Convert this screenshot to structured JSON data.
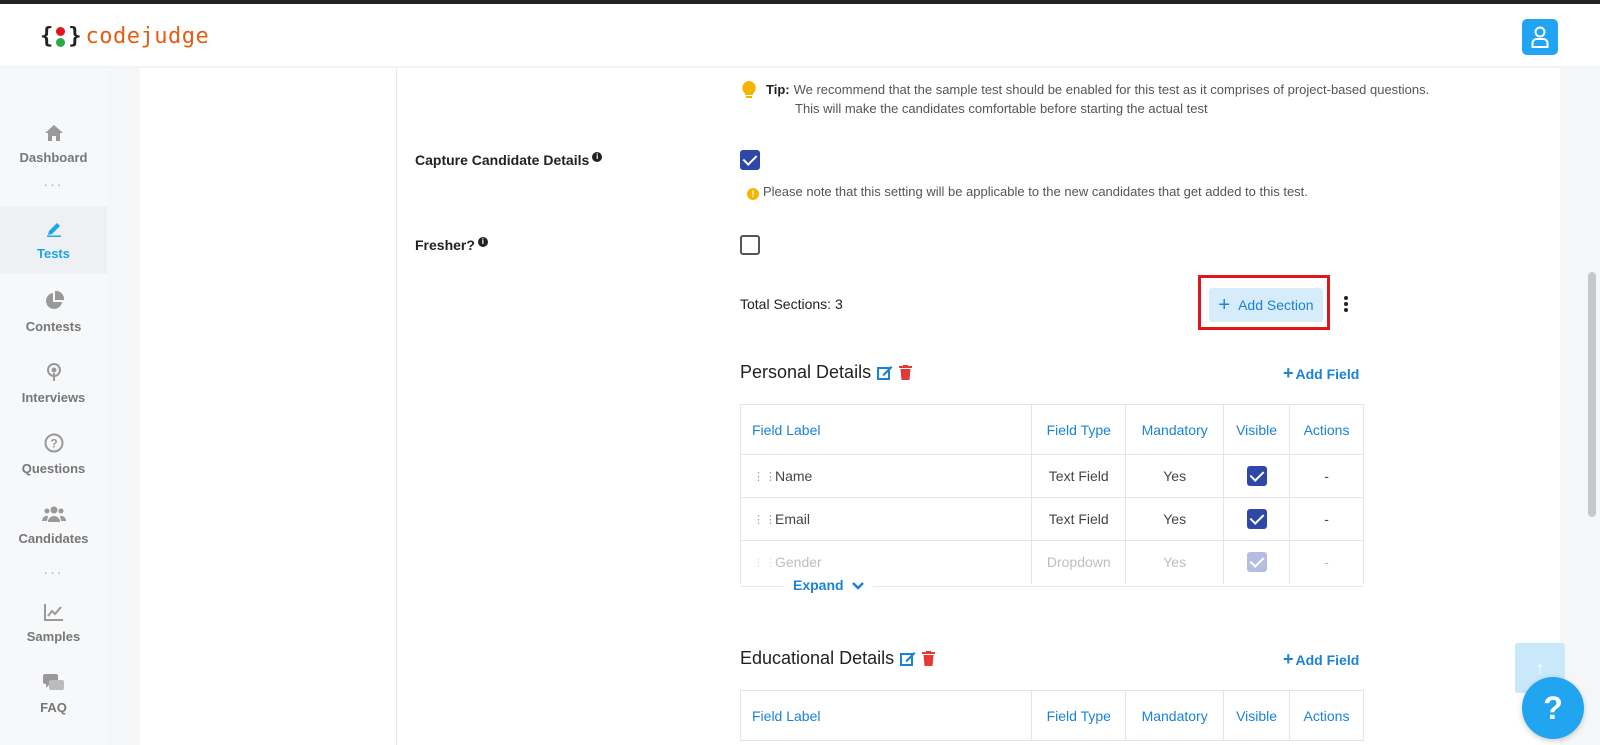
{
  "header": {
    "logo_text": "codejudge",
    "logo_braces_left": "{",
    "logo_braces_right": "}"
  },
  "sidebar": {
    "items": [
      {
        "label": "Dashboard",
        "icon": "home-icon"
      },
      {
        "label": "Tests",
        "icon": "pencil-icon",
        "active": true
      },
      {
        "label": "Contests",
        "icon": "pie-chart-icon"
      },
      {
        "label": "Interviews",
        "icon": "broadcast-icon"
      },
      {
        "label": "Questions",
        "icon": "question-circle-icon"
      },
      {
        "label": "Candidates",
        "icon": "users-icon"
      },
      {
        "label": "Samples",
        "icon": "trend-chart-icon"
      },
      {
        "label": "FAQ",
        "icon": "chat-bubbles-icon"
      }
    ],
    "separator": "···"
  },
  "tip": {
    "label": "Tip:",
    "line1": "We recommend that the sample test should be enabled for this test as it comprises of project-based questions.",
    "line2": "This will make the candidates comfortable before starting the actual test"
  },
  "settings": {
    "capture_label": "Capture Candidate Details",
    "capture_checked": true,
    "capture_note": "Please note that this setting will be applicable to the new candidates that get added to this test.",
    "fresher_label": "Fresher?",
    "fresher_checked": false,
    "info_glyph": "i",
    "note_glyph": "!"
  },
  "sections": {
    "total_label": "Total Sections: 3",
    "add_section_label": "Add Section",
    "add_field_label": "Add Field",
    "plus_glyph": "+",
    "columns": [
      "Field Label",
      "Field Type",
      "Mandatory",
      "Visible",
      "Actions"
    ],
    "personal": {
      "title": "Personal Details",
      "rows": [
        {
          "label": "Name",
          "type": "Text Field",
          "mandatory": "Yes",
          "visible": true,
          "actions": "-"
        },
        {
          "label": "Email",
          "type": "Text Field",
          "mandatory": "Yes",
          "visible": true,
          "actions": "-"
        },
        {
          "label": "Gender",
          "type": "Dropdown",
          "mandatory": "Yes",
          "visible": true,
          "actions": "-"
        }
      ],
      "expand_label": "Expand"
    },
    "educational": {
      "title": "Educational Details"
    }
  },
  "floating": {
    "help_glyph": "?",
    "scroll_top_glyph": "↑"
  },
  "colors": {
    "accent": "#1a82d8",
    "brand_orange": "#e45d15",
    "highlight_red": "#e0161b",
    "checkbox_blue": "#2f48a8"
  }
}
